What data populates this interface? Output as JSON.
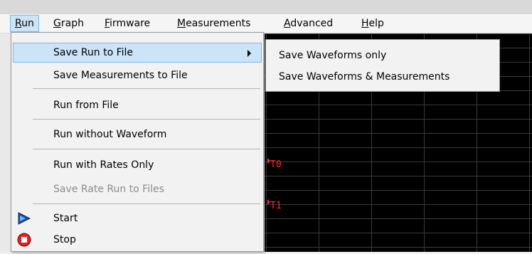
{
  "menubar": {
    "items": [
      {
        "label": "Run",
        "accel": "R",
        "rest": "un"
      },
      {
        "label": "Graph",
        "accel": "G",
        "rest": "raph"
      },
      {
        "label": "Firmware",
        "accel": "F",
        "rest": "irmware"
      },
      {
        "label": "Measurements",
        "accel": "M",
        "rest": "easurements"
      },
      {
        "label": "Advanced",
        "accel": "A",
        "rest": "dvanced"
      },
      {
        "label": "Help",
        "accel": "H",
        "rest": "elp"
      }
    ]
  },
  "run_menu": {
    "items": [
      {
        "label": "Save Run to File",
        "highlighted": true,
        "has_submenu": true
      },
      {
        "label": "Save Measurements to File"
      },
      {
        "label": "Run from File"
      },
      {
        "label": "Run without Waveform"
      },
      {
        "label": "Run with Rates Only"
      },
      {
        "label": "Save Rate Run to Files",
        "disabled": true
      },
      {
        "label": "Start",
        "icon": "start-play-icon"
      },
      {
        "label": "Stop",
        "icon": "stop-icon"
      }
    ]
  },
  "submenu": {
    "items": [
      {
        "label": "Save Waveforms only"
      },
      {
        "label": "Save Waveforms & Measurements"
      }
    ]
  },
  "graph": {
    "markers": [
      {
        "label": "T0"
      },
      {
        "label": "T1"
      }
    ],
    "marker_color": "#ff2a2a",
    "background": "#000000"
  },
  "colors": {
    "highlight": "#cce4f7",
    "highlight_border": "#7fb8e6",
    "disabled_text": "#8d8d8d"
  }
}
